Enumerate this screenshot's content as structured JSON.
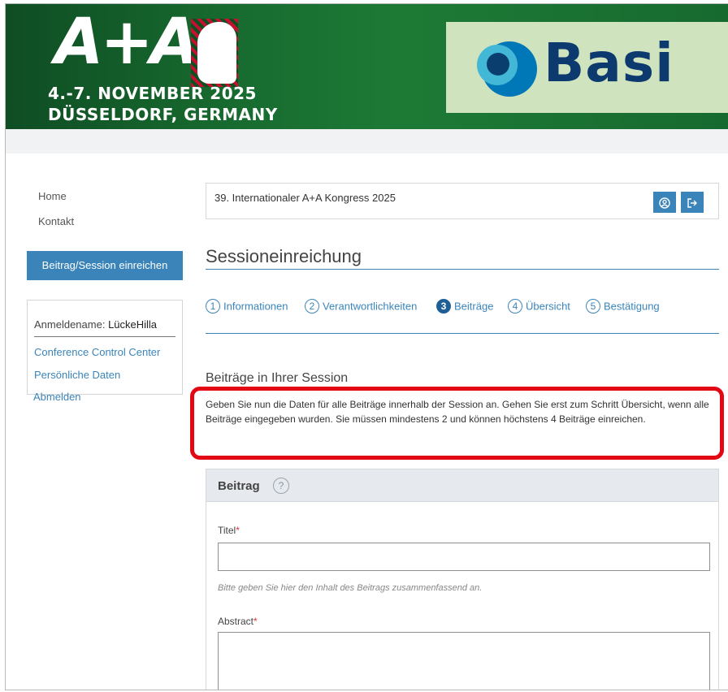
{
  "banner": {
    "logo_text": "A+A",
    "date": "4.-7. NOVEMBER 2025",
    "place": "DÜSSELDORF, GERMANY",
    "sponsor_name": "Basi"
  },
  "sidebar": {
    "nav": [
      {
        "label": "Home"
      },
      {
        "label": "Kontakt"
      }
    ],
    "cta_label": "Beitrag/Session einreichen",
    "user": {
      "prefix": "Anmeldename: ",
      "name": "LückeHilla",
      "links": [
        {
          "label": "Conference Control Center"
        },
        {
          "label": "Persönliche Daten"
        },
        {
          "label": "Abmelden"
        }
      ]
    }
  },
  "main": {
    "conference_title": "39. Internationaler A+A Kongress 2025",
    "page_title": "Sessioneinreichung",
    "steps": [
      {
        "num": "1",
        "label": "Informationen",
        "active": false
      },
      {
        "num": "2",
        "label": "Verantwortlichkeiten",
        "active": false
      },
      {
        "num": "3",
        "label": "Beiträge",
        "active": true
      },
      {
        "num": "4",
        "label": "Übersicht",
        "active": false
      },
      {
        "num": "5",
        "label": "Bestätigung",
        "active": false
      }
    ],
    "section_title": "Beiträge in Ihrer Session",
    "info_text": "Geben Sie nun die Daten für alle Beiträge innerhalb der Session an. Gehen Sie erst zum Schritt Übersicht, wenn alle Beiträge eingegeben wurden. Sie müssen mindestens 2 und können höchstens 4 Beiträge einreichen.",
    "card": {
      "title": "Beitrag",
      "help_symbol": "?",
      "title_field_label": "Titel",
      "title_field_value": "",
      "title_hint": "Bitte geben Sie hier den Inhalt des Beitrags zusammenfassend an.",
      "abstract_label": "Abstract",
      "abstract_value": "",
      "required_marker": "*"
    }
  },
  "colors": {
    "accent": "#3a84b9",
    "banner_green": "#176a2f",
    "highlight_red": "#e30613"
  },
  "icons": {
    "profile": "user-circle-icon",
    "logout": "sign-out-icon"
  }
}
